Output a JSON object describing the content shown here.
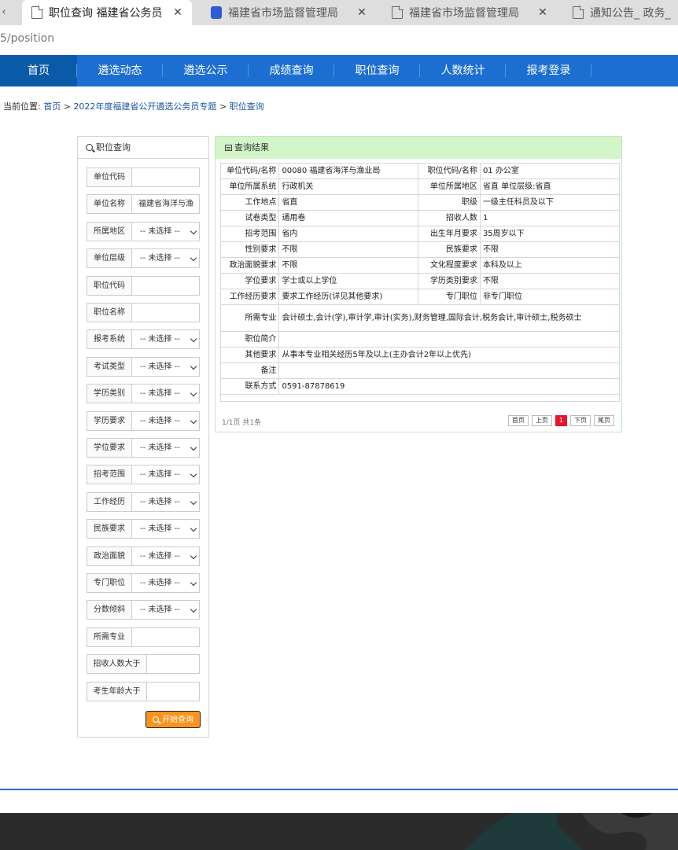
{
  "browser": {
    "tabs": [
      {
        "title": "职位查询 福建省公务员",
        "close": "✕",
        "icon": "document-icon",
        "active": true
      },
      {
        "title": "福建省市场监督管理局",
        "close": "✕",
        "icon": "paw-icon",
        "active": false
      },
      {
        "title": "福建省市场监督管理局",
        "close": "✕",
        "icon": "document-icon",
        "active": false
      },
      {
        "title": "通知公告_ 政务_",
        "close": "",
        "icon": "document-icon",
        "active": false
      }
    ],
    "scroll_left": "‹",
    "address": "5/position"
  },
  "nav": {
    "items": [
      "首页",
      "遴选动态",
      "遴选公示",
      "成绩查询",
      "职位查询",
      "人数统计",
      "报考登录"
    ]
  },
  "breadcrumb": {
    "prefix": "当前位置:",
    "home": "首页",
    "sep": ">",
    "topic": "2022年度福建省公开遴选公务员专题",
    "current": "职位查询"
  },
  "filter": {
    "title": "职位查询",
    "fields": [
      {
        "label": "单位代码",
        "type": "input",
        "value": ""
      },
      {
        "label": "单位名称",
        "type": "input",
        "value": "福建省海洋与渔"
      },
      {
        "label": "所属地区",
        "type": "select",
        "value": "-- 未选择 --"
      },
      {
        "label": "单位层级",
        "type": "select",
        "value": "-- 未选择 --"
      },
      {
        "label": "职位代码",
        "type": "input",
        "value": ""
      },
      {
        "label": "职位名称",
        "type": "input",
        "value": ""
      },
      {
        "label": "报考系统",
        "type": "select",
        "value": "-- 未选择 --"
      },
      {
        "label": "考试类型",
        "type": "select",
        "value": "-- 未选择 --"
      },
      {
        "label": "学历类别",
        "type": "select",
        "value": "-- 未选择 --"
      },
      {
        "label": "学历要求",
        "type": "select",
        "value": "-- 未选择 --"
      },
      {
        "label": "学位要求",
        "type": "select",
        "value": "-- 未选择 --"
      },
      {
        "label": "招考范围",
        "type": "select",
        "value": "-- 未选择 --"
      },
      {
        "label": "工作经历",
        "type": "select",
        "value": "-- 未选择 --"
      },
      {
        "label": "民族要求",
        "type": "select",
        "value": "-- 未选择 --"
      },
      {
        "label": "政治面貌",
        "type": "select",
        "value": "-- 未选择 --"
      },
      {
        "label": "专门职位",
        "type": "select",
        "value": "-- 未选择 --"
      },
      {
        "label": "分数倾斜",
        "type": "select",
        "value": "-- 未选择 --"
      },
      {
        "label": "所需专业",
        "type": "input",
        "value": ""
      },
      {
        "label": "招收人数大于",
        "type": "input",
        "value": ""
      },
      {
        "label": "考生年龄大于",
        "type": "input",
        "value": ""
      }
    ],
    "submit": "开始查询"
  },
  "result": {
    "title": "查询结果",
    "rows4": [
      [
        "单位代码/名称",
        "00080 福建省海洋与渔业局",
        "职位代码/名称",
        "01 办公室"
      ],
      [
        "单位所属系统",
        "行政机关",
        "单位所属地区",
        "省直   单位层级:省直"
      ],
      [
        "工作地点",
        "省直",
        "职级",
        "一级主任科员及以下"
      ],
      [
        "试卷类型",
        "通用卷",
        "招收人数",
        "1"
      ],
      [
        "招考范围",
        "省内",
        "出生年月要求",
        "35周岁以下"
      ],
      [
        "性别要求",
        "不限",
        "民族要求",
        "不限"
      ],
      [
        "政治面貌要求",
        "不限",
        "文化程度要求",
        "本科及以上"
      ],
      [
        "学位要求",
        "学士或以上学位",
        "学历类别要求",
        "不限"
      ],
      [
        "工作经历要求",
        "要求工作经历(详见其他要求)",
        "专门职位",
        "非专门职位"
      ]
    ],
    "rows2": [
      [
        "所需专业",
        "会计硕士,会计(学),审计学,审计(实务),财务管理,国际会计,税务会计,审计硕士,税务硕士"
      ],
      [
        "职位简介",
        ""
      ],
      [
        "其他要求",
        "从事本专业相关经历5年及以上(主办会计2年以上优先)"
      ],
      [
        "备注",
        ""
      ],
      [
        "联系方式",
        "0591-87878619"
      ]
    ],
    "page_info": "1/1页 共1条",
    "pager": [
      "首页",
      "上页",
      "1",
      "下页",
      "尾页"
    ]
  },
  "colors": {
    "nav_bg": "#1c6fd1",
    "nav_active": "#0a5aa8",
    "result_head": "#d3f5c8",
    "button": "#f7941d",
    "pager_current": "#e8162c"
  }
}
